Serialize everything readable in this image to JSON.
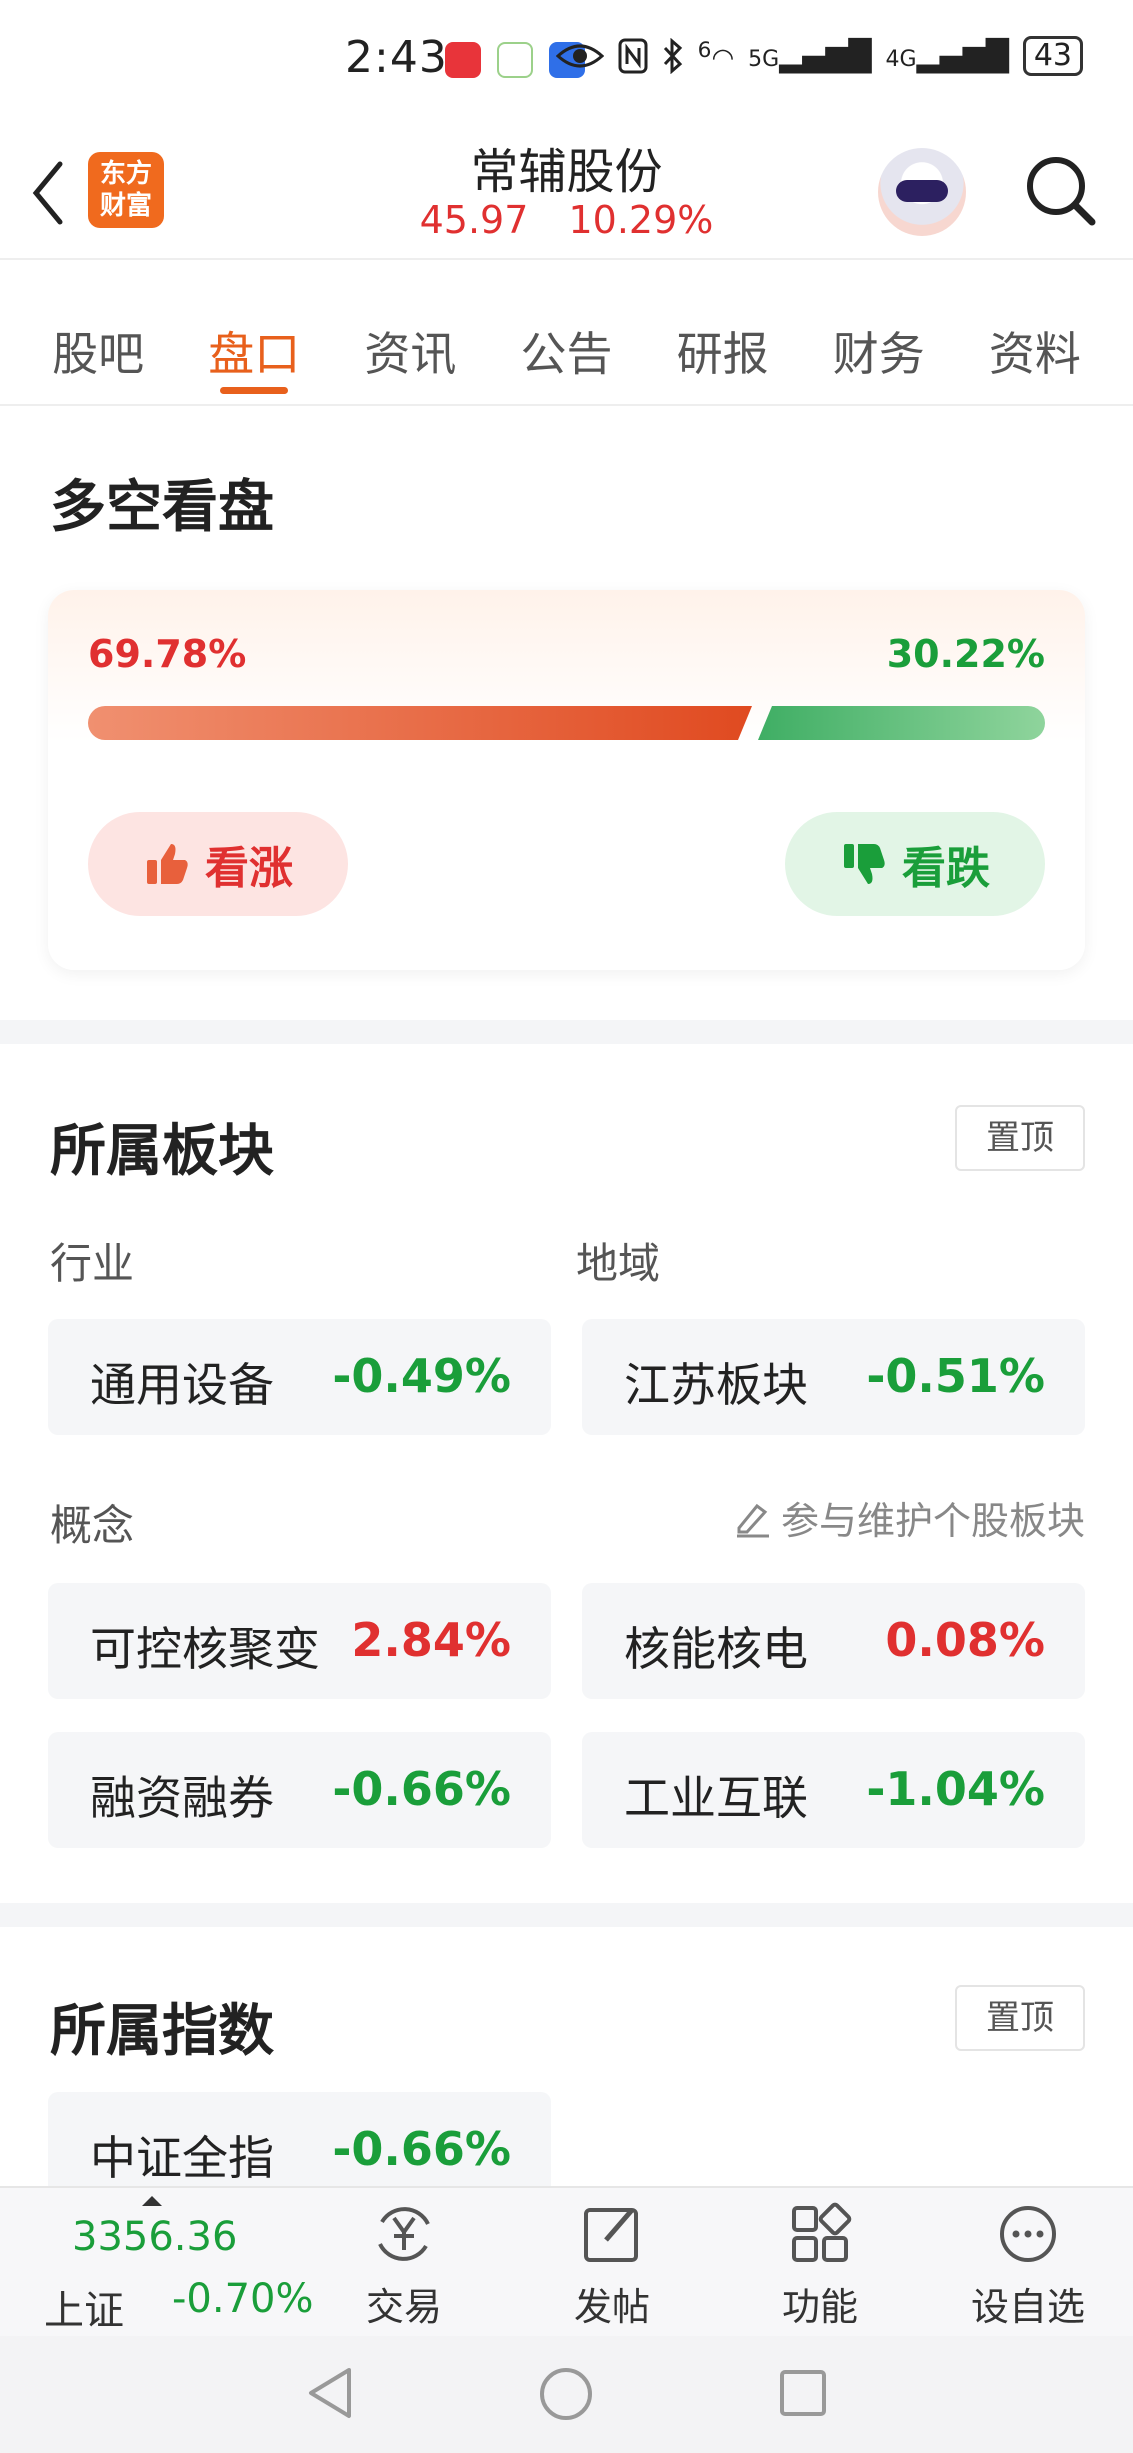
{
  "status_bar": {
    "time": "2:43",
    "network_4g": "4G",
    "network_5g": "5G",
    "wifi_label": "6",
    "battery": "43"
  },
  "header": {
    "logo_text_line1": "东方",
    "logo_text_line2": "财富",
    "stock_name": "常辅股份",
    "price": "45.97",
    "change_pct": "10.29%"
  },
  "tabs": [
    {
      "label": "股吧"
    },
    {
      "label": "盘口"
    },
    {
      "label": "资讯"
    },
    {
      "label": "公告"
    },
    {
      "label": "研报"
    },
    {
      "label": "财务"
    },
    {
      "label": "资料"
    }
  ],
  "active_tab": 1,
  "sentiment": {
    "title": "多空看盘",
    "bull_pct_label": "69.78%",
    "bear_pct_label": "30.22%",
    "bull_fraction": 0.6978,
    "bull_button": "看涨",
    "bear_button": "看跌"
  },
  "sectors": {
    "title": "所属板块",
    "pin_label": "置顶",
    "industry_label": "行业",
    "region_label": "地域",
    "concept_label": "概念",
    "maintain_label": "参与维护个股板块",
    "industry": {
      "name": "通用设备",
      "change": "-0.49%"
    },
    "region": {
      "name": "江苏板块",
      "change": "-0.51%"
    },
    "concepts": [
      {
        "name": "可控核聚变",
        "change": "2.84%",
        "dir": "up"
      },
      {
        "name": "核能核电",
        "change": "0.08%",
        "dir": "up"
      },
      {
        "name": "融资融券",
        "change": "-0.66%",
        "dir": "down"
      },
      {
        "name": "工业互联",
        "change": "-1.04%",
        "dir": "down"
      }
    ]
  },
  "indices": {
    "title": "所属指数",
    "pin_label": "置顶",
    "items": [
      {
        "name": "中证全指",
        "change": "-0.66%"
      }
    ]
  },
  "bottom_nav": {
    "index_value": "3356.36",
    "index_name": "上证",
    "index_change": "-0.70%",
    "items": [
      {
        "label": "交易"
      },
      {
        "label": "发帖"
      },
      {
        "label": "功能"
      },
      {
        "label": "设自选"
      }
    ]
  },
  "colors": {
    "accent": "#e8601c",
    "up": "#e03030",
    "down": "#1a9e3a"
  }
}
